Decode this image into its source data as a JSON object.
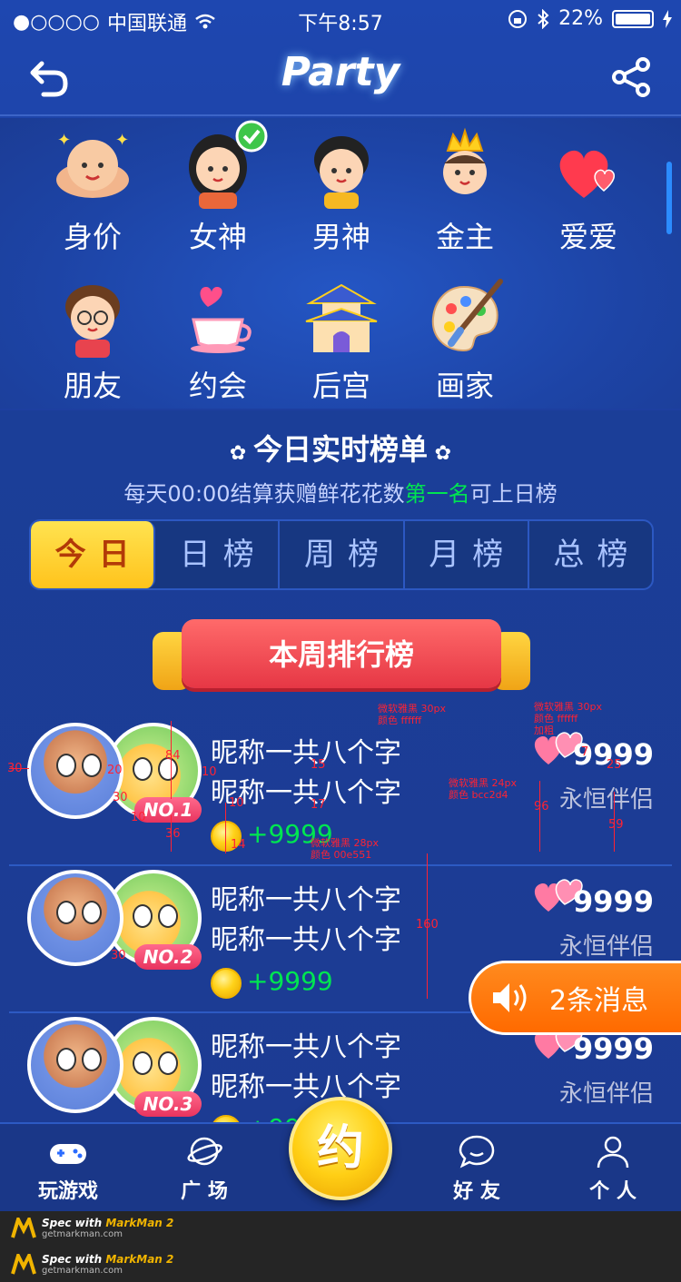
{
  "status_bar": {
    "signal": "●○○○○",
    "carrier": "中国联通",
    "time": "下午8:57",
    "battery": "22%"
  },
  "header": {
    "title": "Party"
  },
  "categories": [
    {
      "label": "身价",
      "icon": "muscle-baby-icon"
    },
    {
      "label": "女神",
      "icon": "goddess-icon",
      "checked": true
    },
    {
      "label": "男神",
      "icon": "male-god-icon"
    },
    {
      "label": "金主",
      "icon": "crown-boy-icon"
    },
    {
      "label": "爱爱",
      "icon": "hearts-icon"
    },
    {
      "label": "朋友",
      "icon": "friend-icon"
    },
    {
      "label": "约会",
      "icon": "date-cup-icon"
    },
    {
      "label": "后宫",
      "icon": "palace-icon"
    },
    {
      "label": "画家",
      "icon": "palette-icon"
    }
  ],
  "ranking": {
    "title": "今日实时榜单",
    "subtitle_pre": "每天00:00结算获赠鲜花花数",
    "subtitle_hl": "第一名",
    "subtitle_post": "可上日榜",
    "tabs": [
      "今日",
      "日榜",
      "周榜",
      "月榜",
      "总榜"
    ],
    "active_tab": 0,
    "banner": "本周排行榜",
    "rows": [
      {
        "rank": "NO.1",
        "nick1": "昵称一共八个字",
        "nick2": "昵称一共八个字",
        "gain": "+9999",
        "score": "9999",
        "relation": "永恒伴侣"
      },
      {
        "rank": "NO.2",
        "nick1": "昵称一共八个字",
        "nick2": "昵称一共八个字",
        "gain": "+9999",
        "score": "9999",
        "relation": "永恒伴侣"
      },
      {
        "rank": "NO.3",
        "nick1": "昵称一共八个字",
        "nick2": "昵称一共八个字",
        "gain": "+9999",
        "score": "9999",
        "relation": "永恒伴侣"
      }
    ]
  },
  "annotations": {
    "nick_font": "微软雅黑 30px",
    "nick_color": "颜色 ffffff",
    "score_font": "微软雅黑 30px",
    "score_color": "颜色 ffffff",
    "score_bold": "加粗",
    "rel_font": "微软雅黑 24px",
    "rel_color": "颜色 bcc2d4",
    "gain_font": "微软雅黑 28px",
    "gain_color": "颜色 00e551",
    "n30a": "30",
    "n20": "20",
    "n84": "84",
    "n10a": "10",
    "n30b": "30",
    "n10b": "10",
    "n36": "36",
    "n10c": "10",
    "n14": "14",
    "n15": "15",
    "n17": "17",
    "n7": "7",
    "n25": "25",
    "n96": "96",
    "n59": "59",
    "n30c": "30",
    "n160": "160"
  },
  "floating_message": {
    "label": "2条消息"
  },
  "tabbar": {
    "items": [
      "玩游戏",
      "广 场",
      "好 友",
      "个 人"
    ],
    "center": "约"
  },
  "footer": {
    "spec_prefix": "Spec with ",
    "spec_brand": "MarkMan 2",
    "url": "getmarkman.com"
  },
  "colors": {
    "accent_green": "#00e551",
    "tab_active": "#ffc31c",
    "message_orange": "#ff6a00"
  }
}
